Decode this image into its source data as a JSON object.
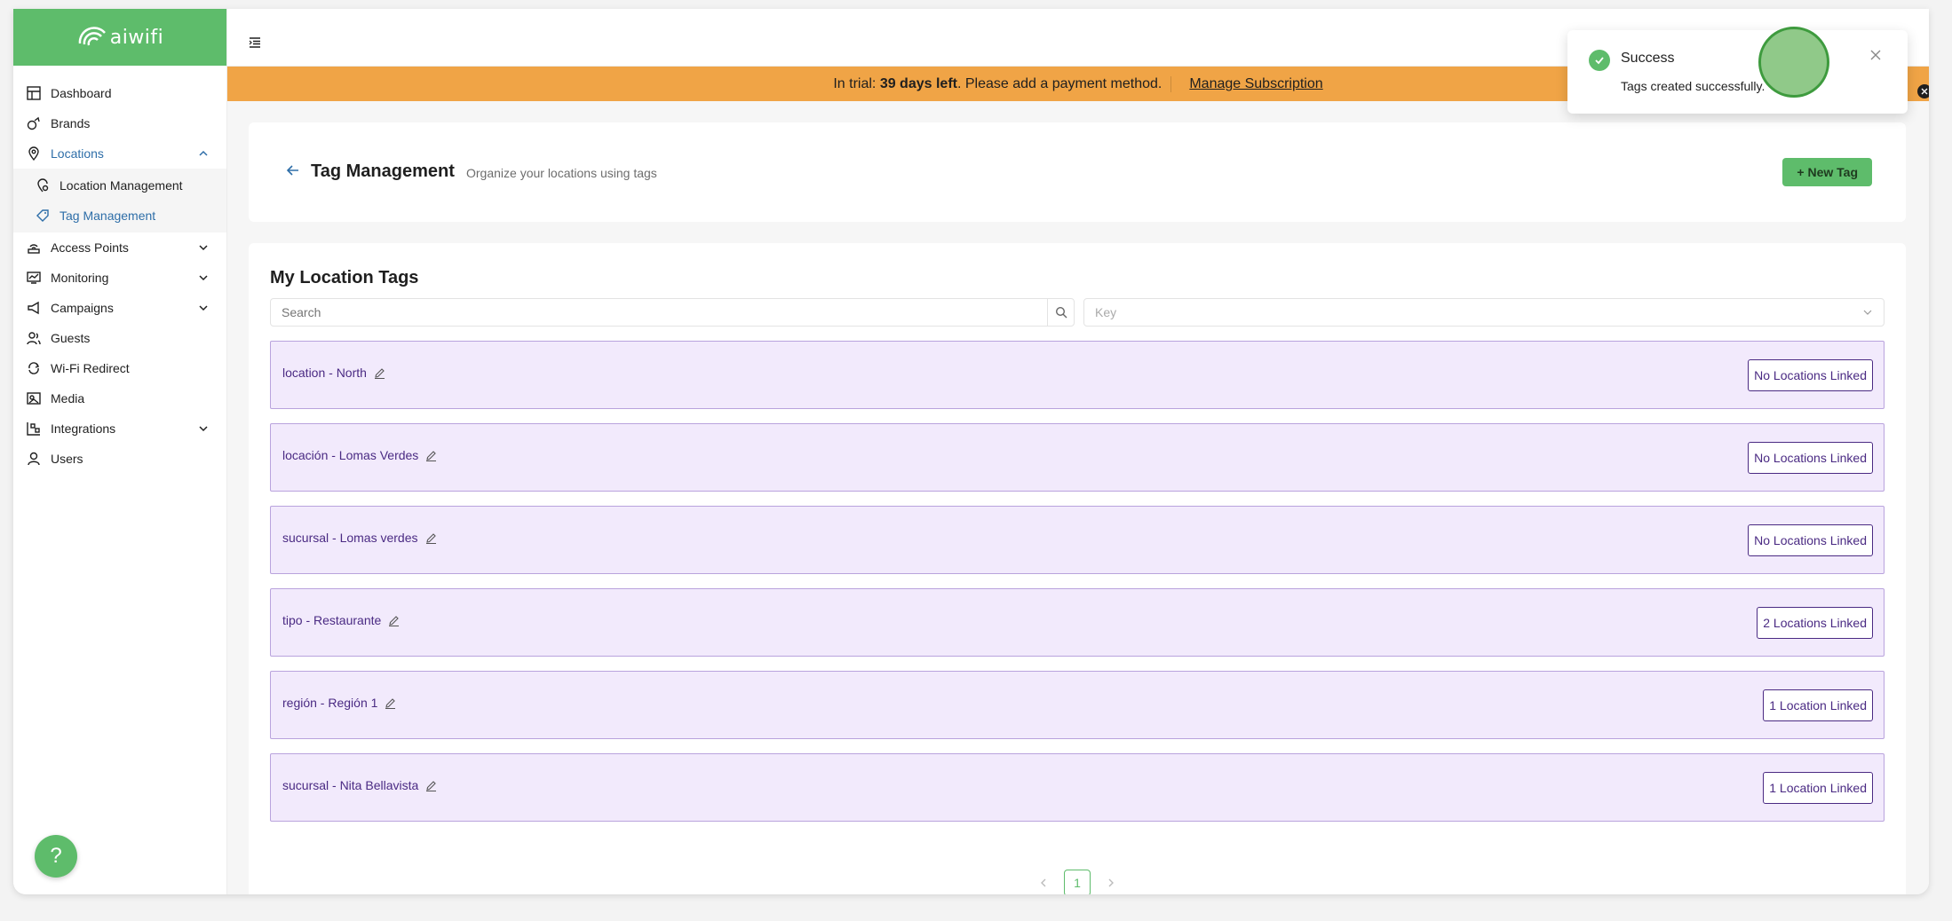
{
  "brand": {
    "name": "aiwifi",
    "color": "#5ebc6b"
  },
  "sidebar": {
    "items": [
      {
        "label": "Dashboard",
        "icon": "dashboard-icon"
      },
      {
        "label": "Brands",
        "icon": "brands-icon"
      },
      {
        "label": "Locations",
        "icon": "location-pin-icon",
        "expanded": true
      },
      {
        "label": "Access Points",
        "icon": "access-point-icon"
      },
      {
        "label": "Monitoring",
        "icon": "monitoring-icon"
      },
      {
        "label": "Campaigns",
        "icon": "megaphone-icon"
      },
      {
        "label": "Guests",
        "icon": "guests-icon"
      },
      {
        "label": "Wi-Fi Redirect",
        "icon": "redirect-icon"
      },
      {
        "label": "Media",
        "icon": "media-icon"
      },
      {
        "label": "Integrations",
        "icon": "integrations-icon"
      },
      {
        "label": "Users",
        "icon": "user-icon"
      }
    ],
    "sub_items": [
      {
        "label": "Location Management",
        "icon": "location-gear-icon"
      },
      {
        "label": "Tag Management",
        "icon": "tag-icon",
        "active": true
      }
    ]
  },
  "trial_banner": {
    "prefix": "In trial:",
    "days_left": "39 days left",
    "suffix": ". Please add a payment method.",
    "link": "Manage Subscription"
  },
  "header": {
    "title": "Tag Management",
    "subtitle": "Organize your locations using tags",
    "new_button": "+ New Tag"
  },
  "list": {
    "title": "My Location Tags",
    "search_placeholder": "Search",
    "key_placeholder": "Key",
    "tags": [
      {
        "label": "location - North",
        "linked": "No Locations Linked"
      },
      {
        "label": "locación - Lomas Verdes",
        "linked": "No Locations Linked"
      },
      {
        "label": "sucursal - Lomas verdes",
        "linked": "No Locations Linked"
      },
      {
        "label": "tipo - Restaurante",
        "linked": "2 Locations Linked"
      },
      {
        "label": "región - Región 1",
        "linked": "1 Location Linked"
      },
      {
        "label": "sucursal - Nita Bellavista",
        "linked": "1 Location Linked"
      }
    ],
    "page": "1"
  },
  "toast": {
    "title": "Success",
    "message": "Tags created successfully."
  },
  "help_label": "?"
}
